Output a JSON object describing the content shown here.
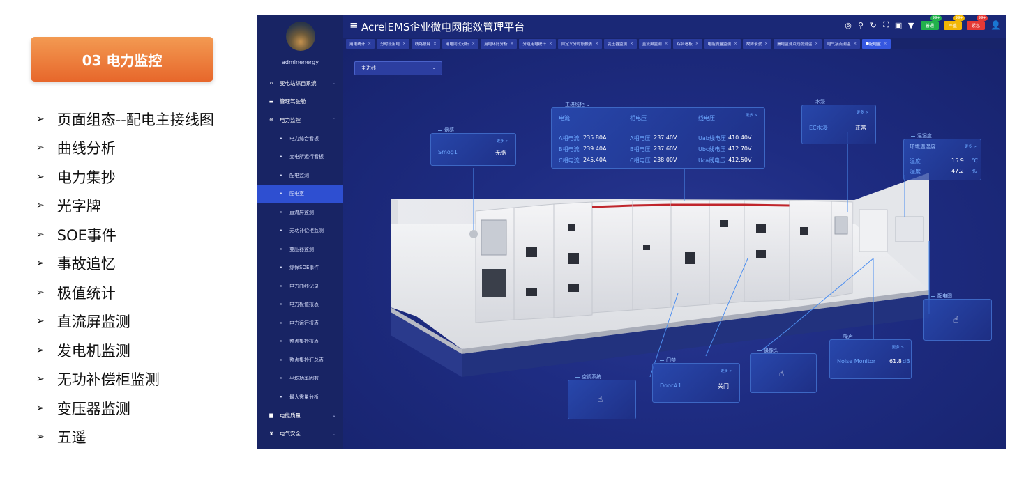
{
  "slide": {
    "badge": "03 电力监控",
    "features": [
      "页面组态--配电主接线图",
      "曲线分析",
      "电力集抄",
      "光字牌",
      "SOE事件",
      "事故追忆",
      "极值统计",
      "直流屏监测",
      "发电机监测",
      "无功补偿柜监测",
      "变压器监测",
      "五遥"
    ]
  },
  "app": {
    "title": "AcrelEMS企业微电网能效管理平台",
    "username": "adminenergy",
    "alarms": [
      {
        "label": "普通",
        "count": "99+",
        "color": "#22b14c"
      },
      {
        "label": "严重",
        "count": "99+",
        "color": "#f2b705"
      },
      {
        "label": "紧急",
        "count": "99+",
        "color": "#e53935"
      }
    ],
    "menu": [
      {
        "label": "变电站综自系统",
        "icon": "home-icon",
        "level": "top",
        "chev": "⌄"
      },
      {
        "label": "管理驾驶舱",
        "icon": "monitor-icon",
        "level": "top"
      },
      {
        "label": "电力监控",
        "icon": "power-icon",
        "level": "top",
        "chev": "⌃"
      },
      {
        "label": "电力综合看板",
        "level": "sub"
      },
      {
        "label": "变电所运行看板",
        "level": "sub"
      },
      {
        "label": "配电监测",
        "level": "sub"
      },
      {
        "label": "配电室",
        "level": "sub",
        "active": true
      },
      {
        "label": "直流屏监测",
        "level": "sub"
      },
      {
        "label": "无功补偿柜监测",
        "level": "sub"
      },
      {
        "label": "变压器监测",
        "level": "sub"
      },
      {
        "label": "综保SOE事件",
        "level": "sub"
      },
      {
        "label": "电力曲线记录",
        "level": "sub"
      },
      {
        "label": "电力极值报表",
        "level": "sub"
      },
      {
        "label": "电力运行报表",
        "level": "sub"
      },
      {
        "label": "整点集抄报表",
        "level": "sub"
      },
      {
        "label": "整点集抄汇总表",
        "level": "sub"
      },
      {
        "label": "平均功率因数",
        "level": "sub"
      },
      {
        "label": "最大需量分析",
        "level": "sub"
      },
      {
        "label": "电能质量",
        "icon": "quality-icon",
        "level": "top",
        "chev": "⌄"
      },
      {
        "label": "电气安全",
        "icon": "safety-icon",
        "level": "top",
        "chev": "⌄"
      }
    ],
    "tabs": [
      "用电统计",
      "分时段用电",
      "线路损耗",
      "用电同比分析",
      "用电环比分析",
      "分组用电统计",
      "自定义分时段报表",
      "变压器监测",
      "直流屏监测",
      "综合看板",
      "电能质量监测",
      "故障录波",
      "漏电监测及线缆测温",
      "电气接点测温",
      "配电室"
    ],
    "selector": "主进线",
    "panels": {
      "smoke": {
        "title": "烟感",
        "more": "更多 >",
        "key": "Smog1",
        "val": "无烟"
      },
      "main": {
        "title": "主进线柜",
        "more": "更多 >",
        "cols": [
          "电流",
          "相电压",
          "线电压"
        ],
        "rows": [
          [
            "A相电流",
            "235.80A",
            "A相电压",
            "237.40V",
            "Uab线电压",
            "410.40V"
          ],
          [
            "B相电流",
            "239.40A",
            "B相电压",
            "237.60V",
            "Ubc线电压",
            "412.70V"
          ],
          [
            "C相电流",
            "245.40A",
            "C相电压",
            "238.00V",
            "Uca线电压",
            "412.50V"
          ]
        ]
      },
      "water": {
        "title": "水浸",
        "more": "更多 >",
        "key": "EC水浸",
        "val": "正常"
      },
      "temp": {
        "title": "温湿度",
        "subtitle": "环境温湿度",
        "more": "更多 >",
        "rows": [
          [
            "温度",
            "15.9",
            "℃"
          ],
          [
            "湿度",
            "47.2",
            "%"
          ]
        ]
      },
      "dist": {
        "title": "配电图"
      },
      "noise": {
        "title": "噪声",
        "more": "更多 >",
        "key": "Noise Monitor",
        "val": "61.8",
        "unit": "dB"
      },
      "camera": {
        "title": "摄像头"
      },
      "door": {
        "title": "门禁",
        "more": "更多 >",
        "key": "Door#1",
        "val": "关门"
      },
      "ac": {
        "title": "空调系统"
      }
    }
  }
}
